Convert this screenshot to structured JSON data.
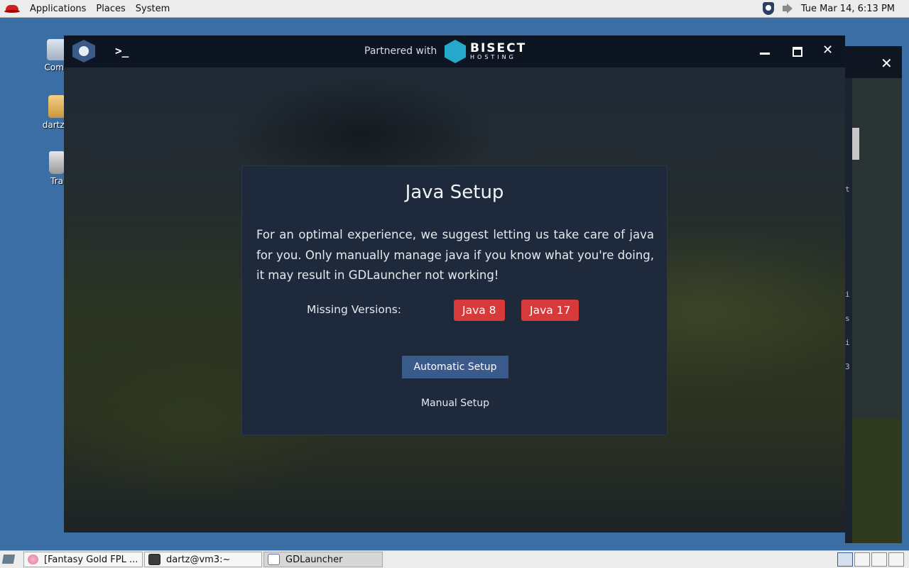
{
  "top_panel": {
    "menus": [
      "Applications",
      "Places",
      "System"
    ],
    "datetime": "Tue Mar 14,  6:13 PM",
    "icons": [
      "redhat-icon",
      "shield-tray-icon",
      "speaker-tray-icon"
    ]
  },
  "desktop_icons": [
    {
      "label": "Comp",
      "icon": "computer-icon"
    },
    {
      "label": "dartz's",
      "icon": "home-folder-icon"
    },
    {
      "label": "Tra",
      "icon": "trash-icon"
    }
  ],
  "app_window": {
    "partner_text": "Partnered with",
    "partner_brand": "BISECT",
    "partner_brand_sub": "HOSTING",
    "dialog": {
      "title": "Java Setup",
      "description": "For an optimal experience, we suggest letting us take care of java for you. Only manually manage java if you know what you're doing, it may result in GDLauncher not working!",
      "missing_label": "Missing Versions:",
      "missing_versions": [
        "Java 8",
        "Java 17"
      ],
      "primary_button": "Automatic Setup",
      "secondary_button": "Manual Setup"
    }
  },
  "background_terminal_chars": [
    "t",
    "i",
    "s",
    "i",
    "3"
  ],
  "taskbar": {
    "tasks": [
      {
        "label": "[Fantasy Gold FPL ...",
        "icon": "browser-icon"
      },
      {
        "label": "dartz@vm3:~",
        "icon": "terminal-icon"
      },
      {
        "label": "GDLauncher",
        "icon": "window-icon"
      }
    ]
  },
  "colors": {
    "badge_red": "#d63a3a",
    "primary_button": "#3a5a8c",
    "dialog_bg": "#1e293b",
    "titlebar_bg": "#0d1422",
    "desktop_bg": "#3a6ea5"
  }
}
